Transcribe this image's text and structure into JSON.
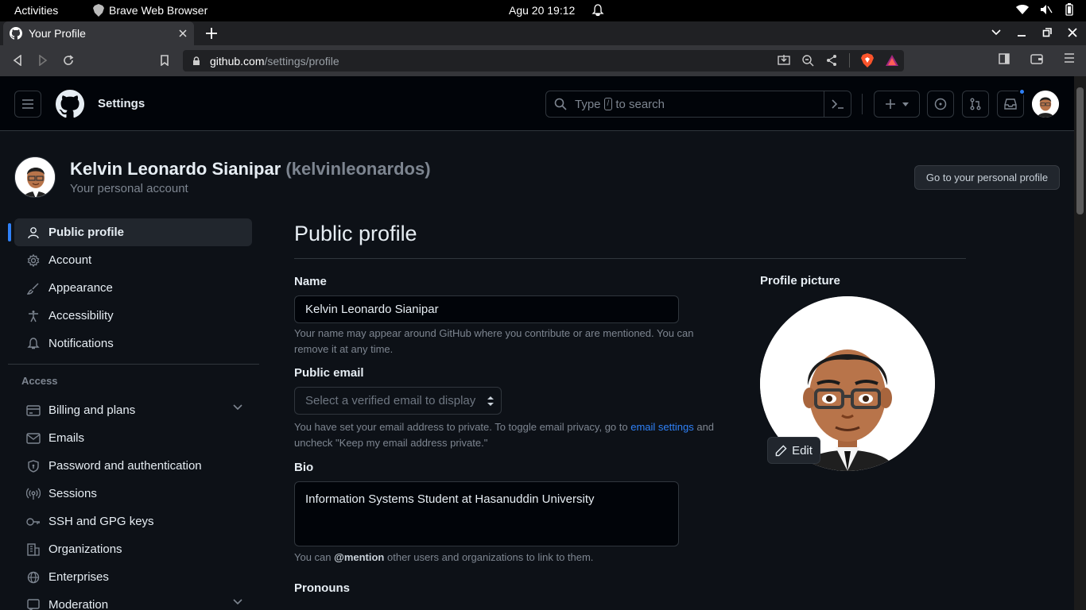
{
  "os": {
    "activities": "Activities",
    "app_name": "Brave Web Browser",
    "clock": "Agu 20  19:12"
  },
  "browser": {
    "tab_title": "Your Profile",
    "url_host": "github.com",
    "url_path": "/settings/profile"
  },
  "header": {
    "title": "Settings",
    "search_prefix": "Type",
    "search_key": "/",
    "search_suffix": "to search"
  },
  "account": {
    "name": "Kelvin Leonardo Sianipar",
    "login": "(kelvinleonardos)",
    "subtitle": "Your personal account",
    "go_profile_label": "Go to your personal profile"
  },
  "sidebar": {
    "items": [
      {
        "label": "Public profile",
        "icon": "person-icon"
      },
      {
        "label": "Account",
        "icon": "gear-icon"
      },
      {
        "label": "Appearance",
        "icon": "paintbrush-icon"
      },
      {
        "label": "Accessibility",
        "icon": "accessibility-icon"
      },
      {
        "label": "Notifications",
        "icon": "bell-icon"
      }
    ],
    "access_heading": "Access",
    "access_items": [
      {
        "label": "Billing and plans",
        "icon": "credit-card-icon"
      },
      {
        "label": "Emails",
        "icon": "mail-icon"
      },
      {
        "label": "Password and authentication",
        "icon": "shield-icon"
      },
      {
        "label": "Sessions",
        "icon": "broadcast-icon"
      },
      {
        "label": "SSH and GPG keys",
        "icon": "key-icon"
      },
      {
        "label": "Organizations",
        "icon": "organization-icon"
      },
      {
        "label": "Enterprises",
        "icon": "globe-icon"
      },
      {
        "label": "Moderation",
        "icon": "report-icon"
      }
    ]
  },
  "main": {
    "heading": "Public profile",
    "name_label": "Name",
    "name_value": "Kelvin Leonardo Sianipar",
    "name_hint": "Your name may appear around GitHub where you contribute or are mentioned. You can remove it at any time.",
    "email_label": "Public email",
    "email_placeholder": "Select a verified email to display",
    "email_hint_1": "You have set your email address to private. To toggle email privacy, go to",
    "email_hint_link": "email settings",
    "email_hint_2": "and uncheck \"Keep my email address private.\"",
    "bio_label": "Bio",
    "bio_value": "Information Systems Student at Hasanuddin University",
    "bio_hint_1": "You can",
    "bio_hint_bold": "@mention",
    "bio_hint_2": "other users and organizations to link to them.",
    "pronouns_label": "Pronouns",
    "profile_picture_label": "Profile picture",
    "edit_label": "Edit"
  },
  "colors": {
    "accent": "#2f81f7",
    "background": "#0d1117",
    "header_bg": "#010409"
  }
}
